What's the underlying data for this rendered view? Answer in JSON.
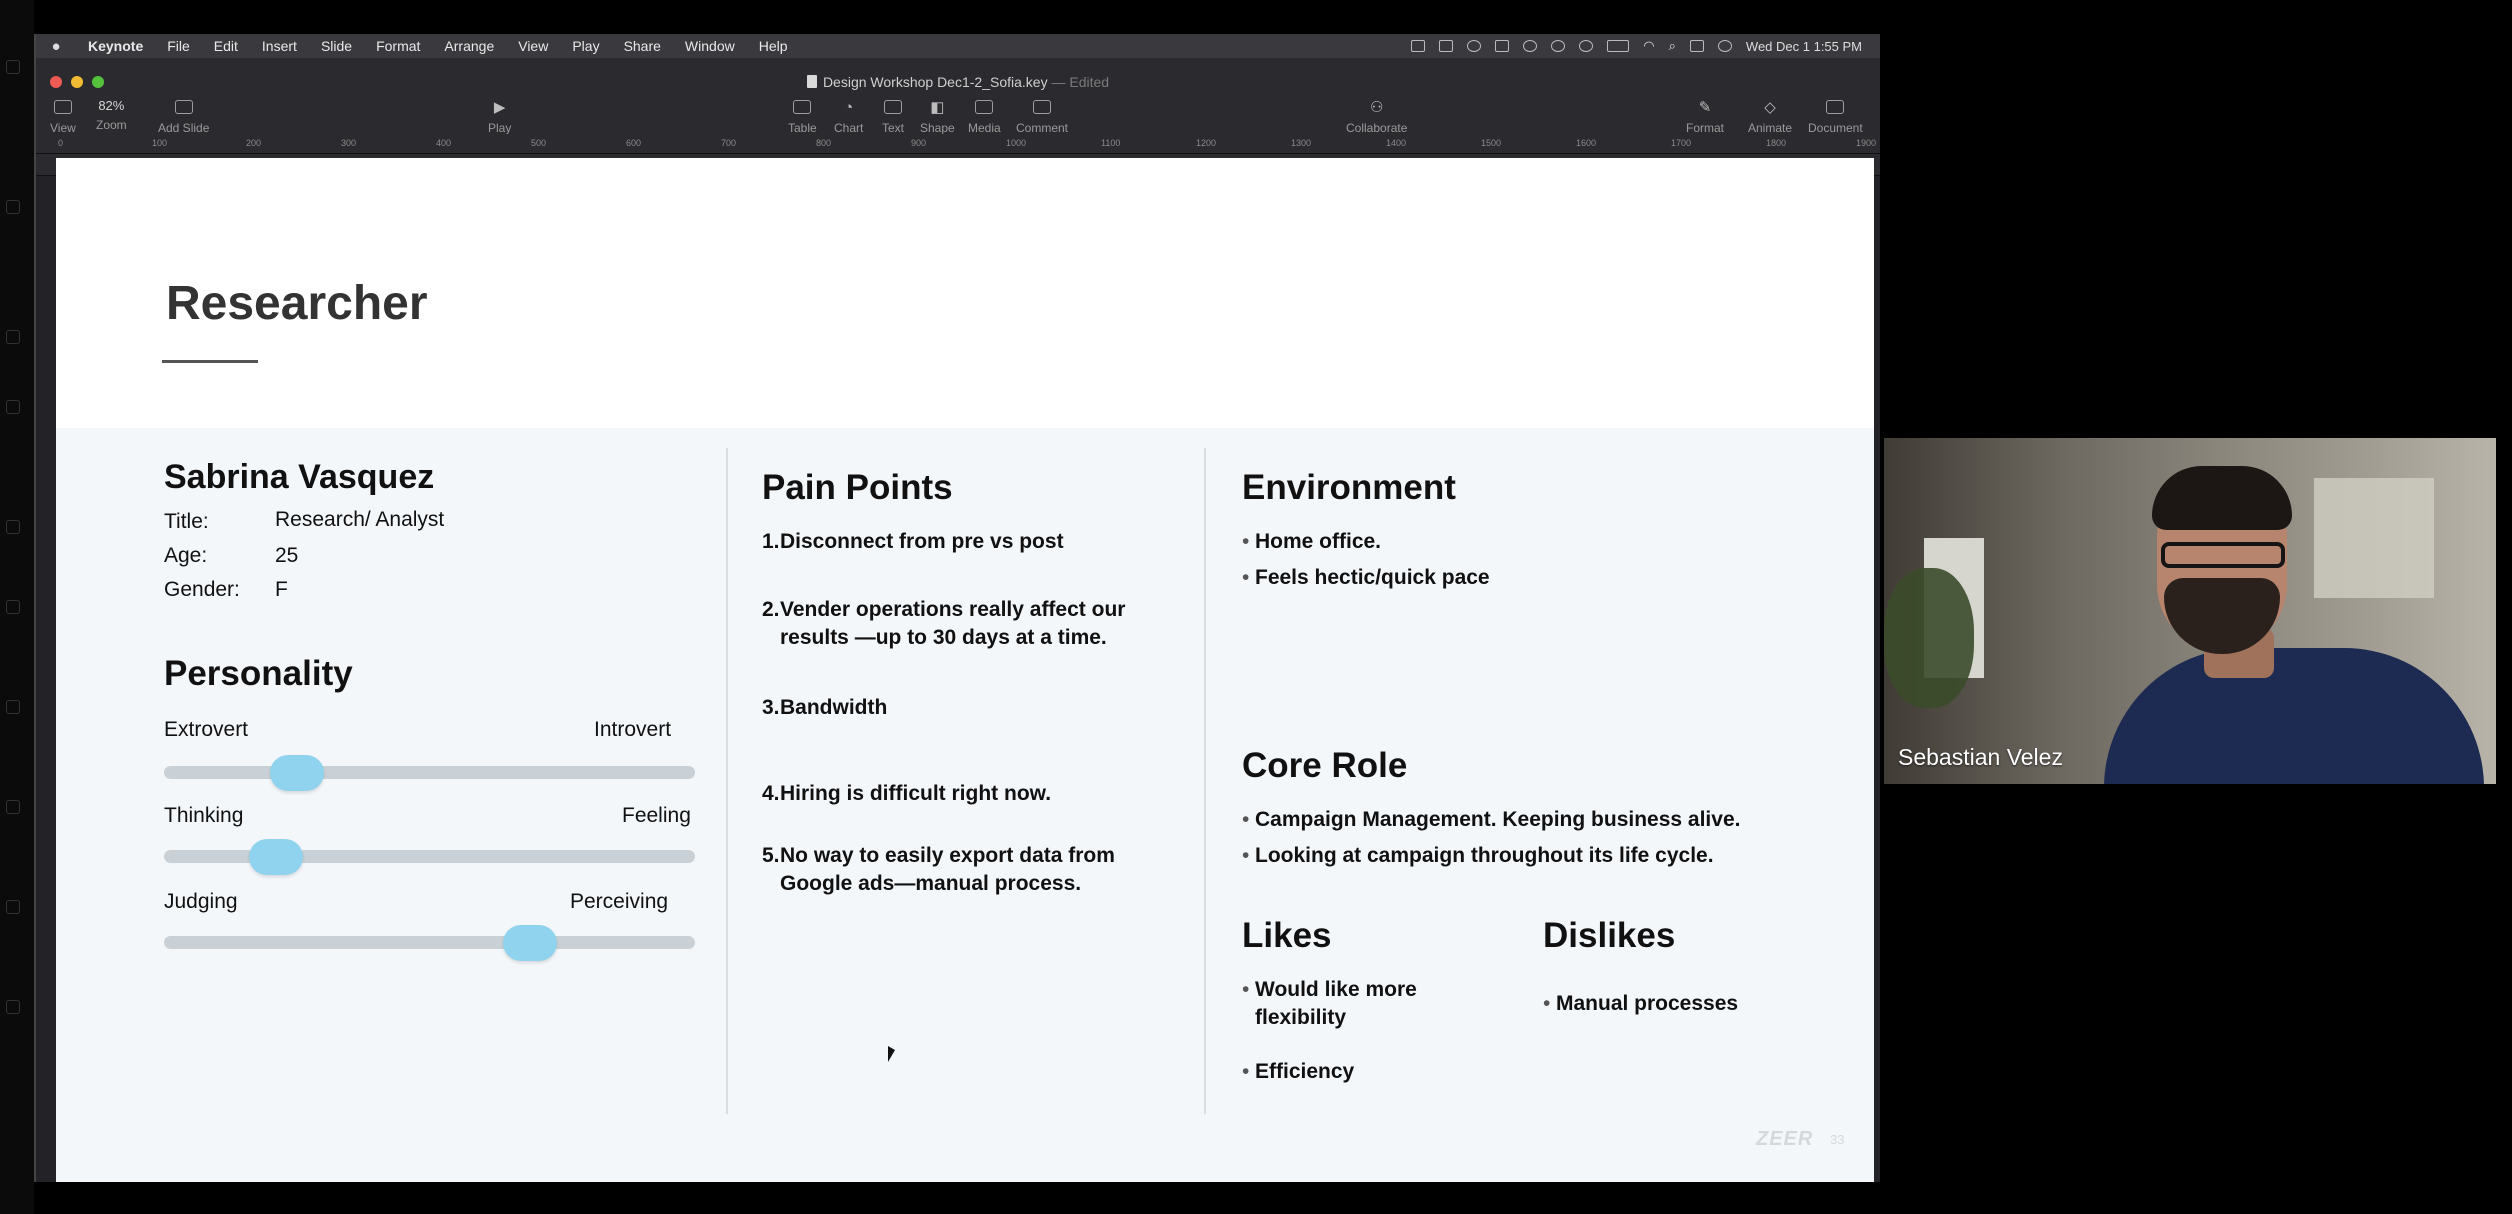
{
  "menubar": {
    "items": [
      "Keynote",
      "File",
      "Edit",
      "Insert",
      "Slide",
      "Format",
      "Arrange",
      "View",
      "Play",
      "Share",
      "Window",
      "Help"
    ],
    "clock": "Wed Dec 1  1:55 PM"
  },
  "window": {
    "title": "Design Workshop Dec1-2_Sofia.key",
    "edited": "— Edited"
  },
  "toolbar": {
    "view_label": "View",
    "zoom_value": "82%",
    "zoom_label": "Zoom",
    "add_slide_label": "Add Slide",
    "play_label": "Play",
    "table_label": "Table",
    "chart_label": "Chart",
    "text_label": "Text",
    "shape_label": "Shape",
    "media_label": "Media",
    "comment_label": "Comment",
    "collaborate_label": "Collaborate",
    "format_label": "Format",
    "animate_label": "Animate",
    "document_label": "Document"
  },
  "ruler": {
    "ticks": [
      "0",
      "100",
      "200",
      "300",
      "400",
      "500",
      "600",
      "700",
      "800",
      "900",
      "1000",
      "1100",
      "1200",
      "1300",
      "1400",
      "1500",
      "1600",
      "1700",
      "1800",
      "1900"
    ]
  },
  "slide": {
    "title": "Researcher",
    "persona": {
      "name": "Sabrina Vasquez",
      "title_label": "Title:",
      "title_value": "Research/ Analyst",
      "age_label": "Age:",
      "age_value": "25",
      "gender_label": "Gender:",
      "gender_value": "F"
    },
    "personality": {
      "heading": "Personality",
      "sliders": [
        {
          "left": "Extrovert",
          "right": "Introvert",
          "level": 0.25
        },
        {
          "left": "Thinking",
          "right": "Feeling",
          "level": 0.21
        },
        {
          "left": "Judging",
          "right": "Perceiving",
          "level": 0.69
        }
      ]
    },
    "pain_points": {
      "heading": "Pain Points",
      "items": [
        {
          "num": "1.",
          "text": "Disconnect from pre vs post"
        },
        {
          "num": "2.",
          "text": "Vender operations really affect our results —up to 30 days at a time."
        },
        {
          "num": "3.",
          "text": "Bandwidth"
        },
        {
          "num": "4.",
          "text": "Hiring is difficult right now."
        },
        {
          "num": "5.",
          "text": "No way to easily export data from Google ads—manual process."
        }
      ]
    },
    "environment": {
      "heading": "Environment",
      "items": [
        "Home office.",
        "Feels hectic/quick pace"
      ]
    },
    "core_role": {
      "heading": "Core Role",
      "items": [
        "Campaign Management. Keeping business alive.",
        "Looking at campaign throughout its life cycle."
      ]
    },
    "likes": {
      "heading": "Likes",
      "items": [
        "Would like more flexibility",
        "Efficiency"
      ]
    },
    "dislikes": {
      "heading": "Dislikes",
      "items": [
        "Manual processes"
      ]
    },
    "footer_logo": "ZEER",
    "page_number": "33"
  },
  "video": {
    "participant_name": "Sebastian Velez"
  },
  "colors": {
    "slider_knob": "#8fd3ef",
    "slider_track": "#c9d1d6",
    "slide_lower_bg": "#f3f7fa"
  }
}
